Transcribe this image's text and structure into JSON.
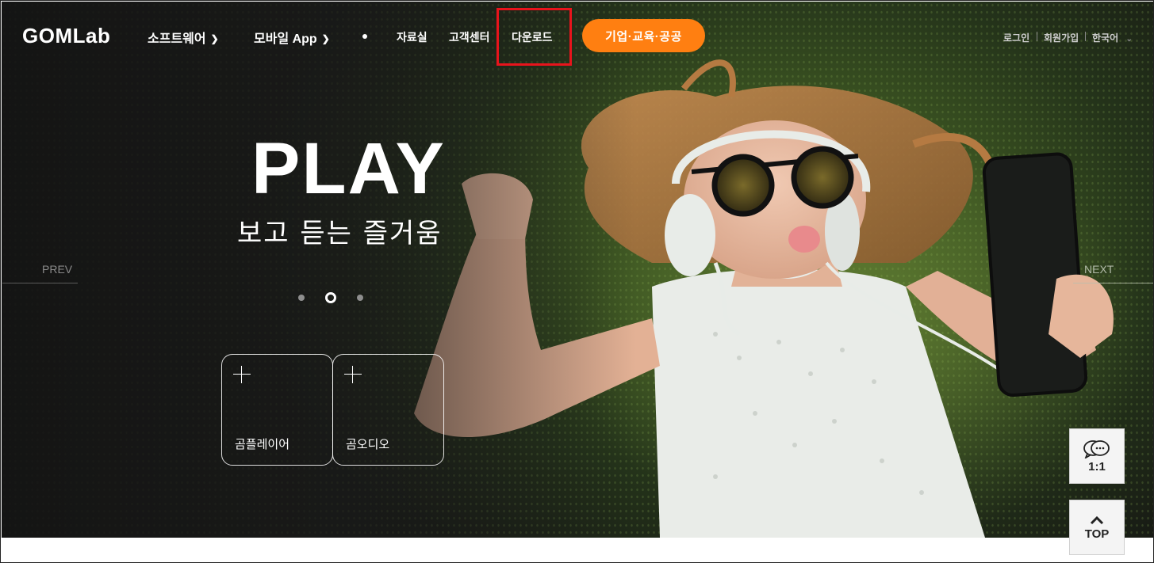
{
  "brand": {
    "logo_main": "GOM",
    "logo_sub": "Lab"
  },
  "nav": {
    "software": "소프트웨어",
    "mobile_app": "모바일 App",
    "resources": "자료실",
    "support": "고객센터",
    "download": "다운로드",
    "cta": "기업·교육·공공"
  },
  "utility": {
    "login": "로그인",
    "signup": "회원가입",
    "language": "한국어"
  },
  "hero": {
    "title": "PLAY",
    "subtitle": "보고 듣는 즐거움",
    "prev": "PREV",
    "next": "NEXT",
    "slides_total": 3,
    "slide_active": 2
  },
  "cards": [
    {
      "label": "곰플레이어"
    },
    {
      "label": "곰오디오"
    }
  ],
  "side": {
    "chat_label": "1:1",
    "top_label": "TOP"
  },
  "colors": {
    "cta": "#ff7f11",
    "highlight": "#e8141c"
  },
  "icons": {
    "chat": "chat-bubbles-icon",
    "top": "chevron-up-icon",
    "menu_chevron": "chevron-down-icon",
    "card_plus": "plus-icon"
  }
}
